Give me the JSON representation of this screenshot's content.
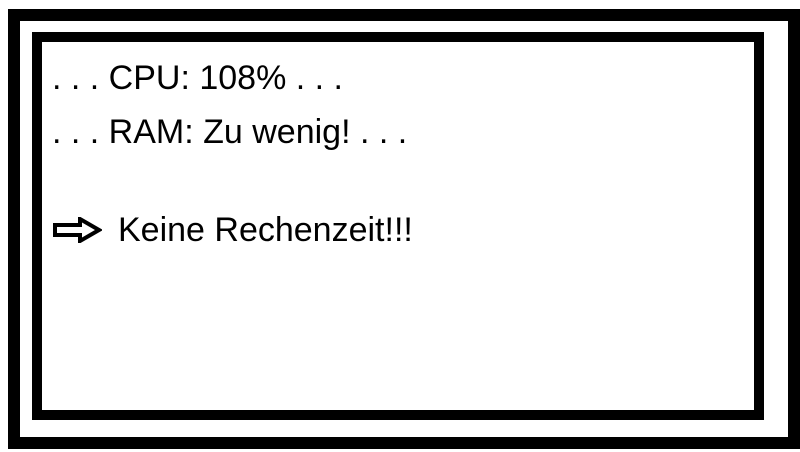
{
  "screen": {
    "cpu_line": ". . . CPU: 108% . . .",
    "ram_line": ". . . RAM: Zu wenig! . . .",
    "message": "Keine Rechenzeit!!!",
    "arrow_icon": "right-arrow-icon",
    "colors": {
      "foreground": "#000000",
      "background": "#ffffff"
    }
  }
}
